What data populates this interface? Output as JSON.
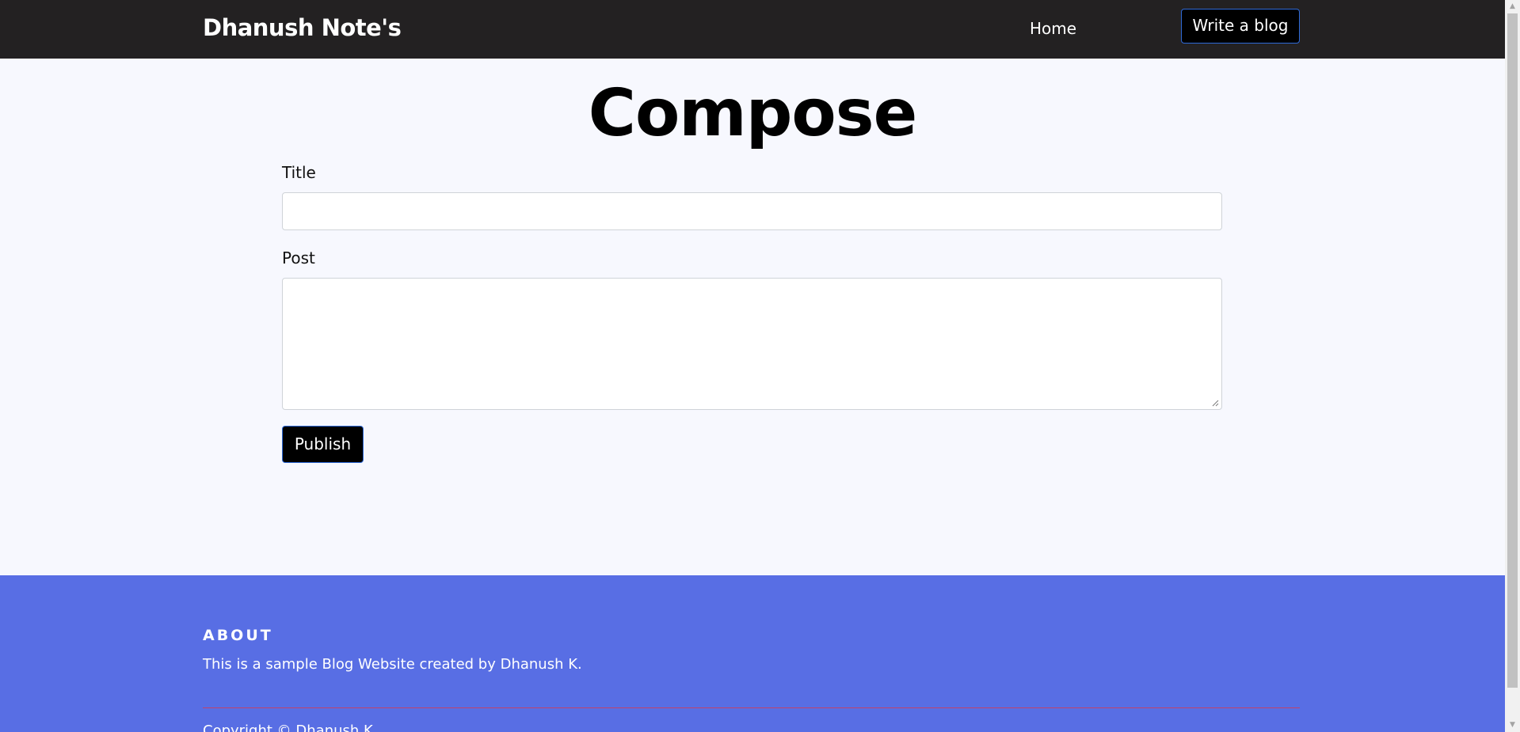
{
  "navbar": {
    "brand": "Dhanush Note's",
    "home_label": "Home",
    "write_label": "Write a blog"
  },
  "main": {
    "heading": "Compose",
    "title_label": "Title",
    "title_value": "",
    "post_label": "Post",
    "post_value": "",
    "publish_label": "Publish"
  },
  "footer": {
    "heading": "ABOUT",
    "text": "This is a sample Blog Website created by Dhanush K.",
    "copyright": "Copyright © Dhanush K"
  },
  "icons": {
    "scroll_up": "scroll-up-arrow-icon",
    "scroll_down": "scroll-down-arrow-icon",
    "resize": "resize-grip-icon"
  },
  "colors": {
    "navbar_bg": "#232122",
    "page_bg": "#f7f8fe",
    "footer_bg": "#586ee4",
    "button_bg": "#000000",
    "button_border": "#2f6ad8",
    "footer_divider": "#c2416a"
  }
}
